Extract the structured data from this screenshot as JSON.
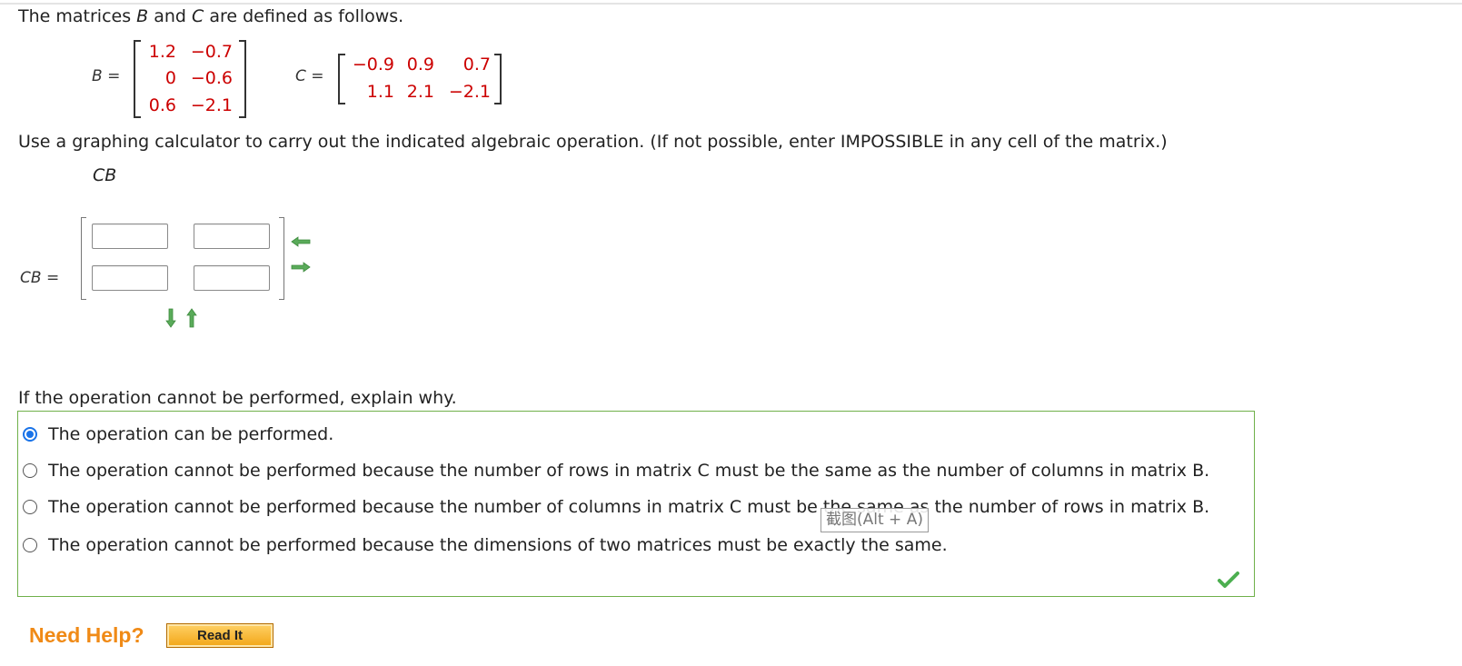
{
  "intro": {
    "prefix": "The matrices ",
    "b": "B",
    "and": " and ",
    "c": "C",
    "suffix": " are defined as follows."
  },
  "matrix_b": {
    "name": "B",
    "eq": "=",
    "rows": [
      [
        "1.2",
        "−0.7"
      ],
      [
        "0",
        "−0.6"
      ],
      [
        "0.6",
        "−2.1"
      ]
    ]
  },
  "matrix_c": {
    "name": "C",
    "eq": "=",
    "rows": [
      [
        "−0.9",
        "0.9",
        "0.7"
      ],
      [
        "1.1",
        "2.1",
        "−2.1"
      ]
    ]
  },
  "instruction": "Use a graphing calculator to carry out the indicated algebraic operation. (If not possible, enter IMPOSSIBLE in any cell of the matrix.)",
  "operation": "CB",
  "answer": {
    "label_name": "CB",
    "label_eq": "=",
    "cells": [
      [
        "",
        ""
      ],
      [
        "",
        ""
      ]
    ]
  },
  "explain_prompt": "If the operation cannot be performed, explain why.",
  "choices": [
    {
      "text": "The operation can be performed.",
      "selected": true
    },
    {
      "text": "The operation cannot be performed because the number of rows in matrix C must be the same as the number of columns in matrix B.",
      "selected": false
    },
    {
      "text": "The operation cannot be performed because the number of columns in matrix C must be the same as the number of rows in matrix B.",
      "selected": false
    },
    {
      "text": "The operation cannot be performed because the dimensions of two matrices must be exactly the same.",
      "selected": false
    }
  ],
  "tooltip": "截图(Alt + A)",
  "help": {
    "label": "Need Help?",
    "read_it": "Read It"
  },
  "colors": {
    "matrix_values": "#cc0000",
    "accent_green": "#6fb04a",
    "radio_blue": "#1a73e8",
    "help_orange": "#f08a16"
  }
}
